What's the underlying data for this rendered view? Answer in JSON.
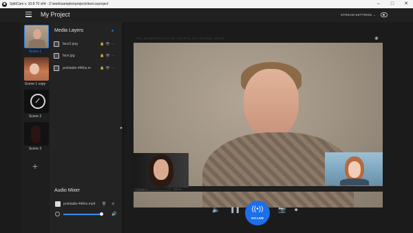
{
  "window": {
    "title": "SplitCam v. 10.8.70 x64 - Z:\\work\\samples\\projects\\test.scproject"
  },
  "header": {
    "title": "My Project",
    "stream_settings_label": "STREAM SETTINGS ⌄"
  },
  "scenes": [
    {
      "label": "Scene 1"
    },
    {
      "label": "Scene 1 copy"
    },
    {
      "label": "Scene 2"
    },
    {
      "label": "Scene 3"
    }
  ],
  "layers_panel": {
    "title": "Media Layers",
    "add_label": "+",
    "items": [
      {
        "label": "face2.png"
      },
      {
        "label": "face.jpg"
      },
      {
        "label": "prokladie-44khz.m"
      }
    ]
  },
  "audio_mixer": {
    "title": "Audio Mixer",
    "source_label": "prokladie-44khz.mp4",
    "volume_fraction": 0.93
  },
  "preview": {
    "stats": "FPS: 30/30(100%)  CPU: 4% / 1%  GPU: 1% / 0%  Audio: 48 kHz",
    "source_name": "Scene 1",
    "zoom": "100 %"
  },
  "controls": {
    "go_live_label": "GO LIVE"
  }
}
